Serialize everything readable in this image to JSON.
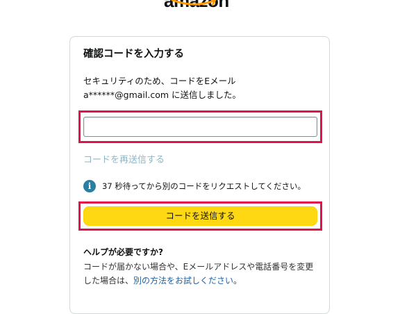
{
  "logo": {
    "text": "amazon"
  },
  "card": {
    "title": "確認コードを入力する",
    "description_line1": "セキュリティのため、コードをEメール",
    "description_line2": "a******@gmail.com に送信しました。",
    "code_input": {
      "value": "",
      "placeholder": ""
    },
    "resend_link": "コードを再送信する",
    "info_text": "37 秒待ってから別のコードをリクエストしてください。",
    "submit_button": "コードを送信する",
    "help": {
      "title": "ヘルプが必要ですか?",
      "line1": "コードが届かない場合や、Eメールアドレスや電話番号を変更",
      "line2_prefix": "した場合は、",
      "line2_link": "別の方法をお試しください",
      "line2_suffix": "。"
    }
  },
  "colors": {
    "accent_button": "#ffd814",
    "highlight_border": "#e0114d",
    "link": "#2162a1",
    "disabled_link": "#8fb6c4",
    "info_icon": "#2a7fa0"
  },
  "icons": {
    "info": "info-icon",
    "logo_smile": "amazon-smile-arrow"
  }
}
